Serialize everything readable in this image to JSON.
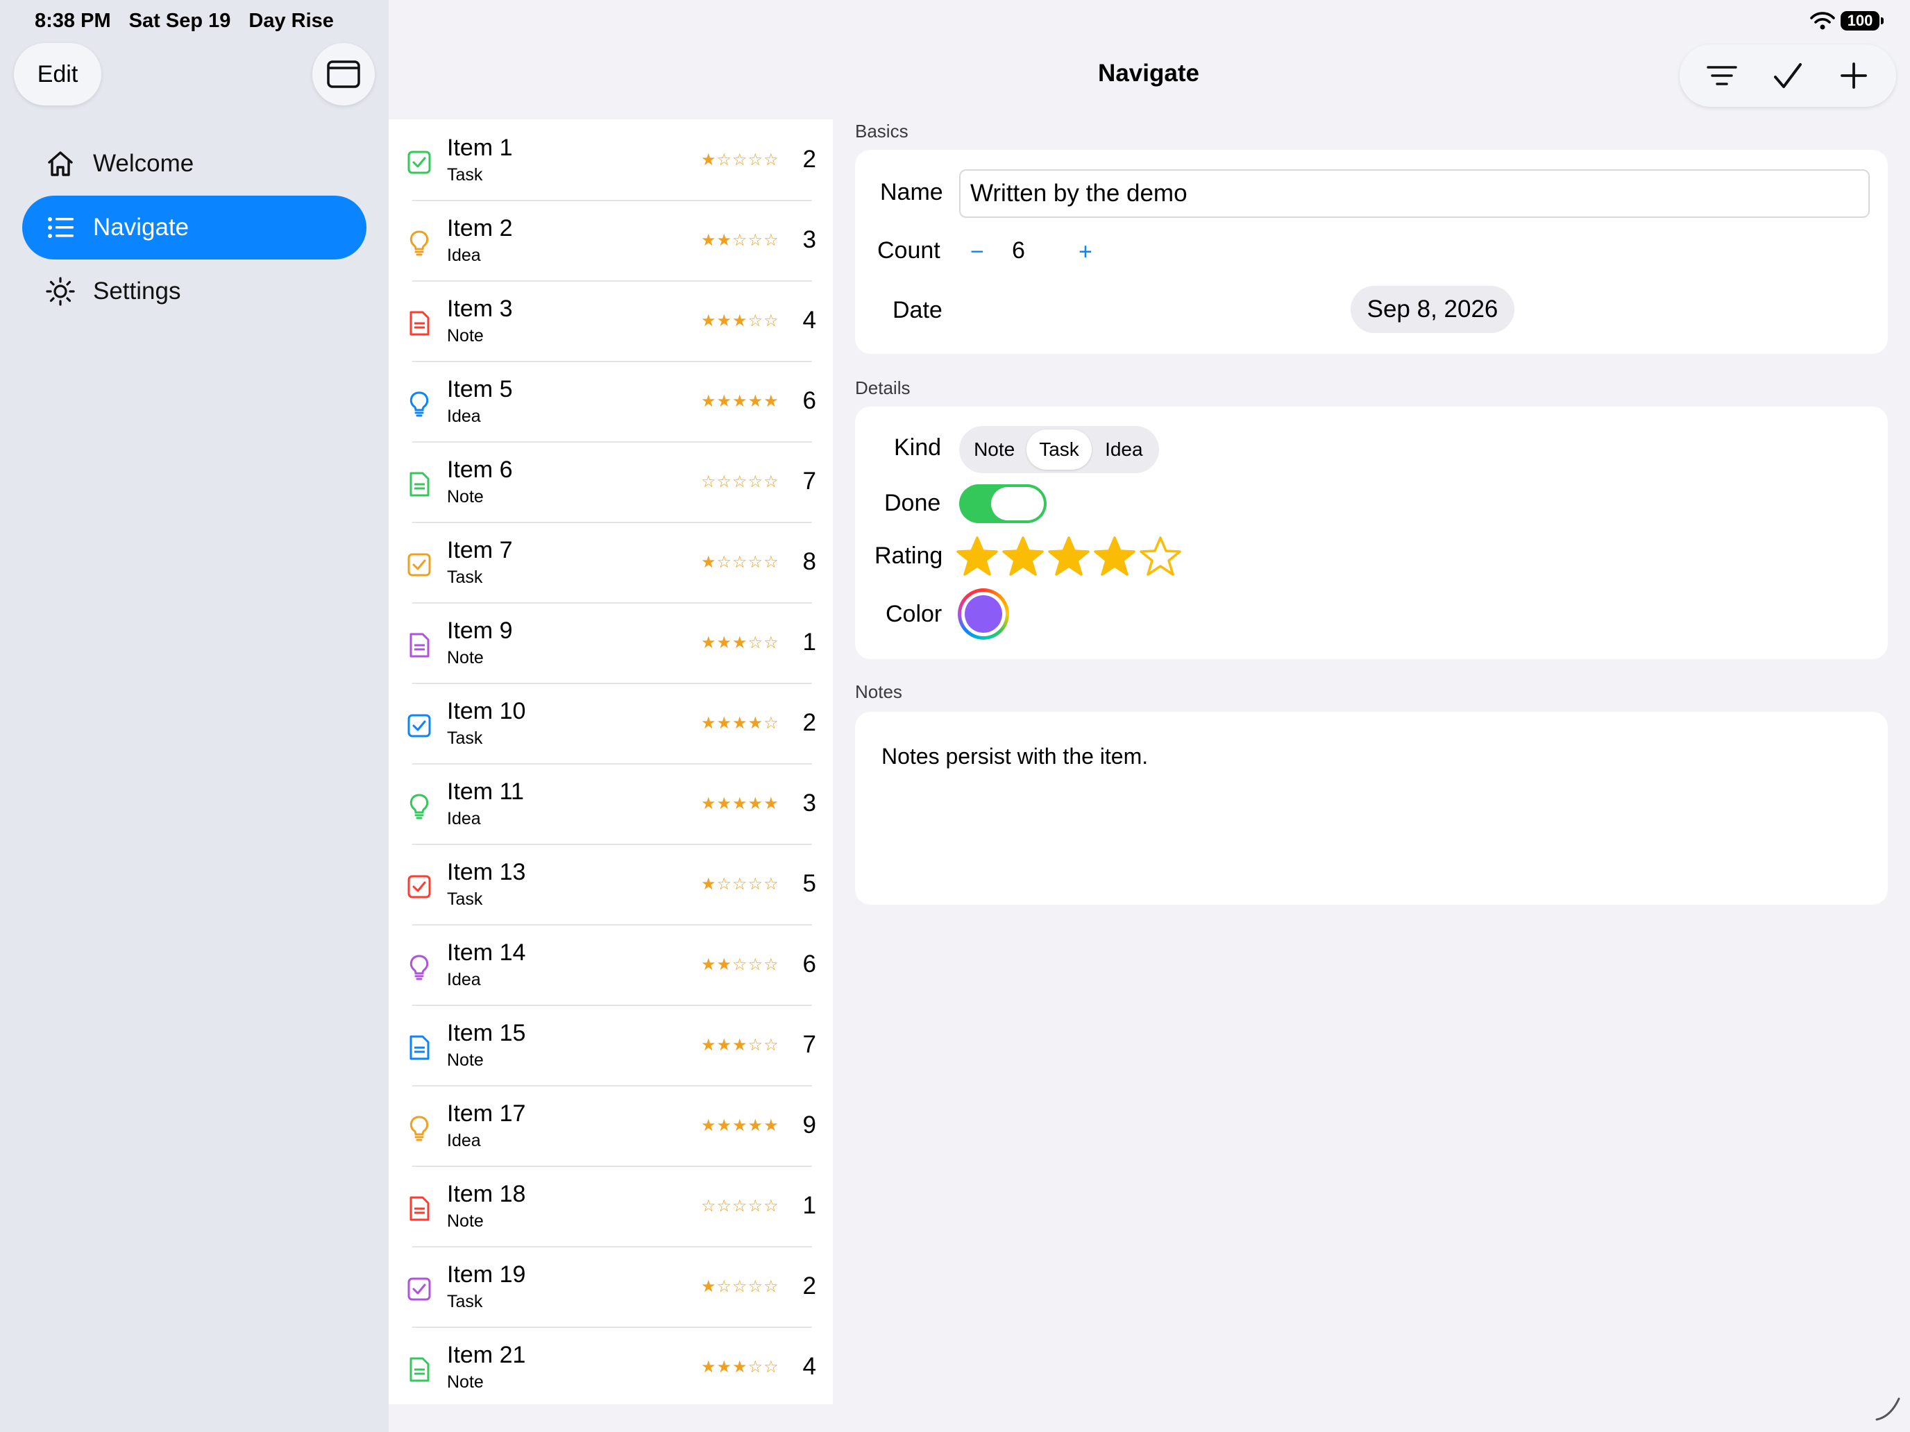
{
  "status": {
    "time": "8:38 PM",
    "date": "Sat Sep 19",
    "app": "Day Rise",
    "battery": "100"
  },
  "sidebar": {
    "edit_label": "Edit",
    "items": [
      {
        "label": "Welcome",
        "icon": "house-icon"
      },
      {
        "label": "Navigate",
        "icon": "list-icon",
        "selected": true
      },
      {
        "label": "Settings",
        "icon": "sun-icon"
      }
    ]
  },
  "header": {
    "title": "Navigate"
  },
  "toolbar": {
    "buttons": [
      "filter-icon",
      "checkmark-icon",
      "plus-icon"
    ]
  },
  "list": {
    "rows": [
      {
        "title": "Item 1",
        "kind": "Task",
        "stars": "★☆☆☆☆",
        "count": "2",
        "color": "#34c759"
      },
      {
        "title": "Item 2",
        "kind": "Idea",
        "stars": "★★☆☆☆",
        "count": "3",
        "color": "#f0a020"
      },
      {
        "title": "Item 3",
        "kind": "Note",
        "stars": "★★★☆☆",
        "count": "4",
        "color": "#ff3b30"
      },
      {
        "title": "Item 5",
        "kind": "Idea",
        "stars": "★★★★★",
        "count": "6",
        "color": "#0a84ff"
      },
      {
        "title": "Item 6",
        "kind": "Note",
        "stars": "☆☆☆☆☆",
        "count": "7",
        "color": "#34c759"
      },
      {
        "title": "Item 7",
        "kind": "Task",
        "stars": "★☆☆☆☆",
        "count": "8",
        "color": "#f0a020"
      },
      {
        "title": "Item 9",
        "kind": "Note",
        "stars": "★★★☆☆",
        "count": "1",
        "color": "#af52de"
      },
      {
        "title": "Item 10",
        "kind": "Task",
        "stars": "★★★★☆",
        "count": "2",
        "color": "#0a84ff"
      },
      {
        "title": "Item 11",
        "kind": "Idea",
        "stars": "★★★★★",
        "count": "3",
        "color": "#34c759"
      },
      {
        "title": "Item 13",
        "kind": "Task",
        "stars": "★☆☆☆☆",
        "count": "5",
        "color": "#ff3b30"
      },
      {
        "title": "Item 14",
        "kind": "Idea",
        "stars": "★★☆☆☆",
        "count": "6",
        "color": "#af52de"
      },
      {
        "title": "Item 15",
        "kind": "Note",
        "stars": "★★★☆☆",
        "count": "7",
        "color": "#0a84ff"
      },
      {
        "title": "Item 17",
        "kind": "Idea",
        "stars": "★★★★★",
        "count": "9",
        "color": "#f0a020"
      },
      {
        "title": "Item 18",
        "kind": "Note",
        "stars": "☆☆☆☆☆",
        "count": "1",
        "color": "#ff3b30"
      },
      {
        "title": "Item 19",
        "kind": "Task",
        "stars": "★☆☆☆☆",
        "count": "2",
        "color": "#af52de"
      },
      {
        "title": "Item 21",
        "kind": "Note",
        "stars": "★★★☆☆",
        "count": "4",
        "color": "#34c759"
      }
    ]
  },
  "detail": {
    "basics": {
      "section": "Basics",
      "name_label": "Name",
      "name_value": "Written by the demo",
      "count_label": "Count",
      "count_minus": "−",
      "count_value": "6",
      "count_plus": "+",
      "date_label": "Date",
      "date_value": "Sep 8, 2026"
    },
    "details": {
      "section": "Details",
      "kind_label": "Kind",
      "kind_options": [
        "Note",
        "Task",
        "Idea"
      ],
      "kind_selected": "Task",
      "done_label": "Done",
      "done": true,
      "rating_label": "Rating",
      "rating": 4,
      "rating_max": 5,
      "color_label": "Color",
      "color_value": "#8b5cf6"
    },
    "notes": {
      "section": "Notes",
      "text": "Notes persist with the item."
    }
  }
}
